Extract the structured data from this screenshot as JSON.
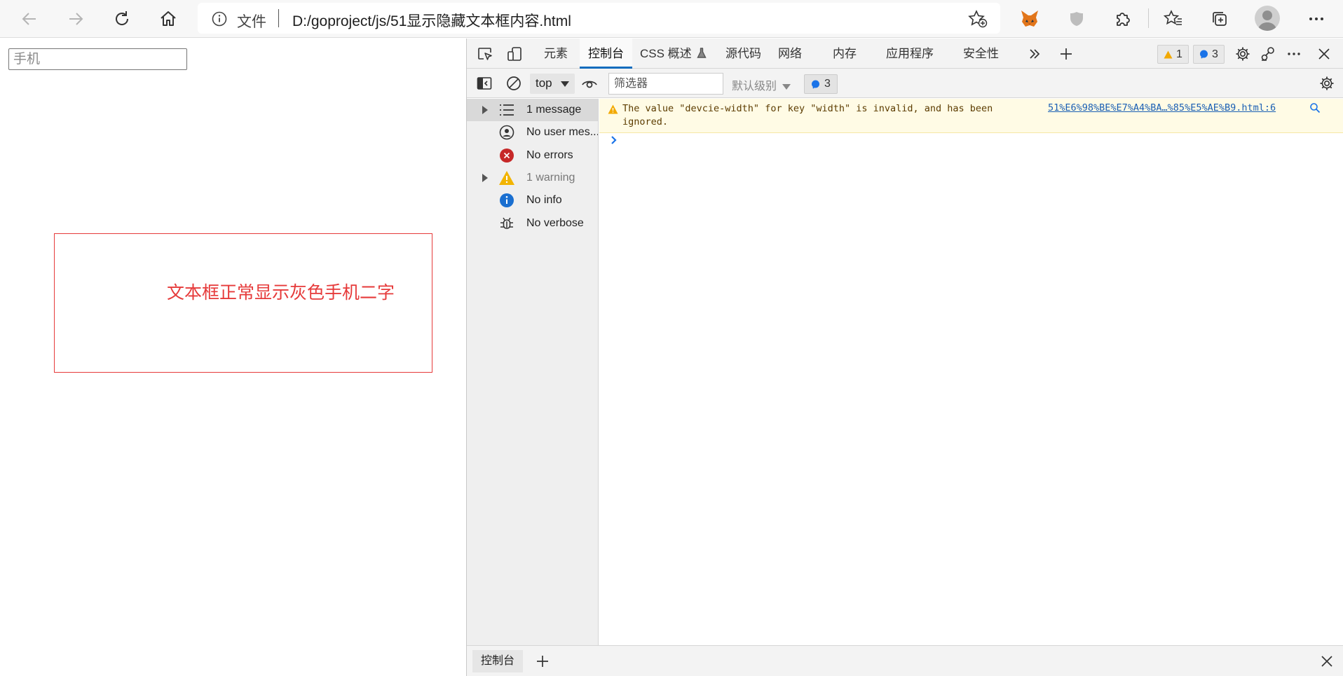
{
  "browser": {
    "address_prefix": "文件",
    "url": "D:/goproject/js/51显示隐藏文本框内容.html"
  },
  "page": {
    "input_placeholder": "手机",
    "note": "文本框正常显示灰色手机二字",
    "note_color": "#e63a3a"
  },
  "devtools": {
    "tabs": [
      {
        "label": "元素"
      },
      {
        "label": "控制台"
      },
      {
        "label": "CSS 概述"
      },
      {
        "label": "源代码"
      },
      {
        "label": "网络"
      },
      {
        "label": "内存"
      },
      {
        "label": "应用程序"
      },
      {
        "label": "安全性"
      }
    ],
    "warning_badge_count": "1",
    "message_badge_count": "3",
    "toolbar": {
      "context": "top",
      "filter_placeholder": "筛选器",
      "levels": "默认级别",
      "message_count": "3"
    },
    "sidebar": [
      {
        "label": "1 message",
        "icon": "list-icon"
      },
      {
        "label": "No user mes...",
        "icon": "user-circle-icon"
      },
      {
        "label": "No errors",
        "icon": "error-icon"
      },
      {
        "label": "1 warning",
        "icon": "warning-icon"
      },
      {
        "label": "No info",
        "icon": "info-icon"
      },
      {
        "label": "No verbose",
        "icon": "bug-icon"
      }
    ],
    "console": {
      "warning_text": "The value \"devcie-width\" for key \"width\" is invalid, and has been ignored.",
      "warning_source": "51%E6%98%BE%E7%A4%BA…%85%E5%AE%B9.html:6"
    },
    "drawer": {
      "tab_label": "控制台"
    }
  }
}
